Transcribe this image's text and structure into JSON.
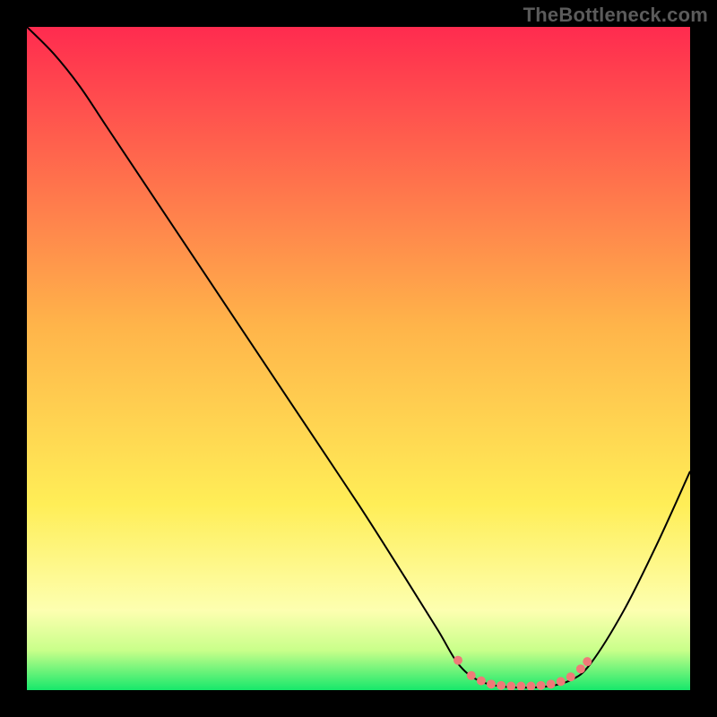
{
  "watermark": "TheBottleneck.com",
  "chart_data": {
    "type": "line",
    "title": "",
    "xlabel": "",
    "ylabel": "",
    "xlim": [
      0,
      100
    ],
    "ylim": [
      0,
      100
    ],
    "grid": false,
    "legend": false,
    "background_gradient": {
      "stops": [
        {
          "offset": 0.0,
          "color": "#ff2b4f"
        },
        {
          "offset": 0.45,
          "color": "#ffb44a"
        },
        {
          "offset": 0.72,
          "color": "#ffee57"
        },
        {
          "offset": 0.88,
          "color": "#fdffb0"
        },
        {
          "offset": 0.94,
          "color": "#c9ff8a"
        },
        {
          "offset": 1.0,
          "color": "#17e86b"
        }
      ]
    },
    "series": [
      {
        "name": "bottleneck-curve",
        "color": "#000000",
        "width": 2,
        "points": [
          {
            "x": 0,
            "y": 100
          },
          {
            "x": 4,
            "y": 96
          },
          {
            "x": 8,
            "y": 91
          },
          {
            "x": 12,
            "y": 85
          },
          {
            "x": 20,
            "y": 73
          },
          {
            "x": 30,
            "y": 58
          },
          {
            "x": 40,
            "y": 43
          },
          {
            "x": 50,
            "y": 28
          },
          {
            "x": 57,
            "y": 17
          },
          {
            "x": 62,
            "y": 9
          },
          {
            "x": 65,
            "y": 4
          },
          {
            "x": 68,
            "y": 1.5
          },
          {
            "x": 72,
            "y": 0.5
          },
          {
            "x": 78,
            "y": 0.5
          },
          {
            "x": 82,
            "y": 1.5
          },
          {
            "x": 85,
            "y": 4
          },
          {
            "x": 90,
            "y": 12
          },
          {
            "x": 95,
            "y": 22
          },
          {
            "x": 100,
            "y": 33
          }
        ]
      },
      {
        "name": "trough-markers",
        "color": "#ef7a78",
        "type": "scatter",
        "marker_radius": 5,
        "points": [
          {
            "x": 65,
            "y": 4.5
          },
          {
            "x": 67,
            "y": 2.2
          },
          {
            "x": 68.5,
            "y": 1.4
          },
          {
            "x": 70,
            "y": 0.9
          },
          {
            "x": 71.5,
            "y": 0.7
          },
          {
            "x": 73,
            "y": 0.6
          },
          {
            "x": 74.5,
            "y": 0.6
          },
          {
            "x": 76,
            "y": 0.6
          },
          {
            "x": 77.5,
            "y": 0.7
          },
          {
            "x": 79,
            "y": 0.9
          },
          {
            "x": 80.5,
            "y": 1.3
          },
          {
            "x": 82,
            "y": 2.0
          },
          {
            "x": 83.5,
            "y": 3.2
          },
          {
            "x": 84.5,
            "y": 4.3
          }
        ]
      }
    ]
  }
}
